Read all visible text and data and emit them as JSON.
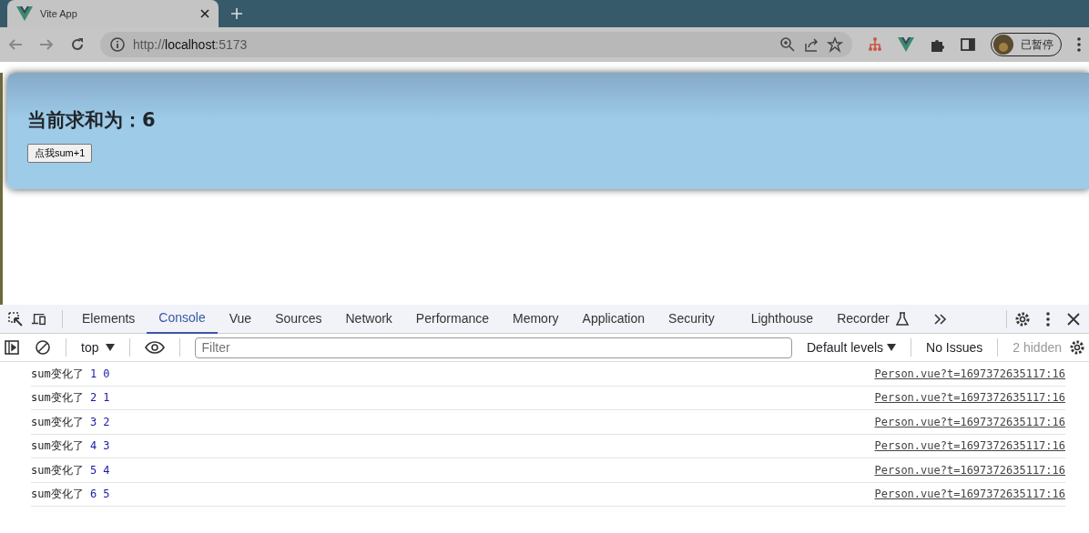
{
  "browser": {
    "tab_title": "Vite App",
    "url_scheme": "http://",
    "url_host": "localhost",
    "url_port": ":5173",
    "profile_label": "已暂停"
  },
  "page": {
    "heading": "当前求和为：6",
    "button": "点我sum+1"
  },
  "devtools": {
    "tabs": [
      {
        "label": "Elements",
        "selected": false
      },
      {
        "label": "Console",
        "selected": true
      },
      {
        "label": "Vue",
        "selected": false
      },
      {
        "label": "Sources",
        "selected": false
      },
      {
        "label": "Network",
        "selected": false
      },
      {
        "label": "Performance",
        "selected": false
      },
      {
        "label": "Memory",
        "selected": false
      },
      {
        "label": "Application",
        "selected": false
      },
      {
        "label": "Security",
        "selected": false
      },
      {
        "label": "Lighthouse",
        "selected": false
      },
      {
        "label": "Recorder",
        "selected": false
      }
    ],
    "context": "top",
    "filter_placeholder": "Filter",
    "levels": "Default levels",
    "issues": "No Issues",
    "hidden": "2 hidden",
    "messages": [
      {
        "text": "sum变化了",
        "new": "1",
        "old": "0",
        "source": "Person.vue?t=1697372635117:16"
      },
      {
        "text": "sum变化了",
        "new": "2",
        "old": "1",
        "source": "Person.vue?t=1697372635117:16"
      },
      {
        "text": "sum变化了",
        "new": "3",
        "old": "2",
        "source": "Person.vue?t=1697372635117:16"
      },
      {
        "text": "sum变化了",
        "new": "4",
        "old": "3",
        "source": "Person.vue?t=1697372635117:16"
      },
      {
        "text": "sum变化了",
        "new": "5",
        "old": "4",
        "source": "Person.vue?t=1697372635117:16"
      },
      {
        "text": "sum变化了",
        "new": "6",
        "old": "5",
        "source": "Person.vue?t=1697372635117:16"
      }
    ]
  }
}
